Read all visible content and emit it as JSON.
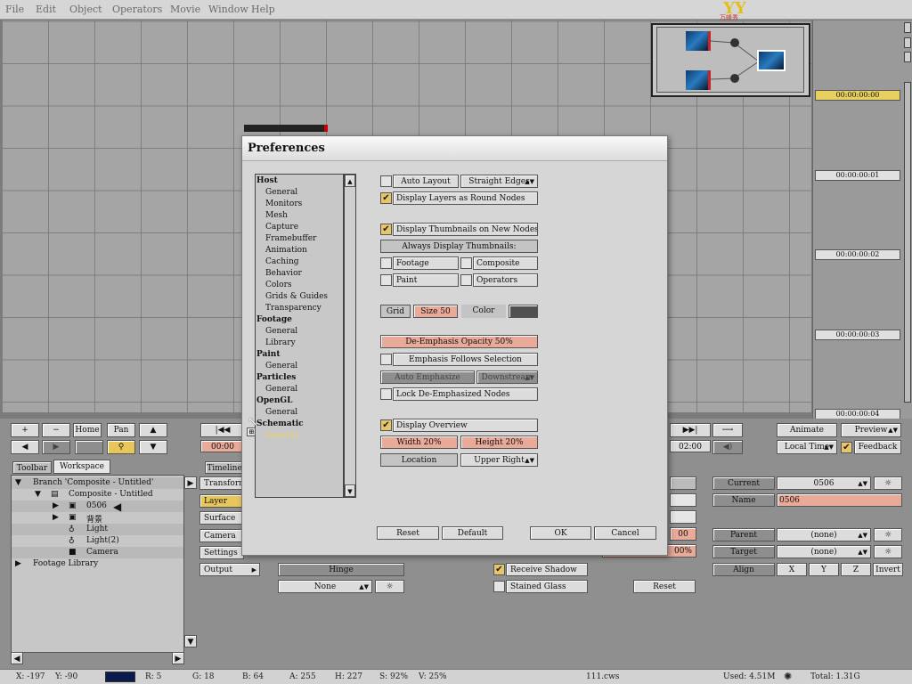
{
  "menu": [
    "File",
    "Edit",
    "Object",
    "Operators",
    "Movie",
    "Window",
    "Help"
  ],
  "logo": {
    "text": "YY",
    "sub": "万峰秀"
  },
  "timeline": {
    "times": [
      "00:00:00:00",
      "00:00:00:01",
      "00:00:00:02",
      "00:00:00:03",
      "00:00:00:04"
    ]
  },
  "toolbar": {
    "add": "+",
    "remove": "−",
    "home": "Home",
    "pan": "Pan",
    "start_time": "00:00",
    "end_time": "02:00",
    "animate": "Animate",
    "preview": "Preview",
    "local_time": "Local Time",
    "feedback": "Feedback"
  },
  "tabs": {
    "toolbar": "Toolbar",
    "workspace": "Workspace",
    "timeline": "Timeline"
  },
  "tree": [
    {
      "text": "Branch 'Composite - Untitled'"
    },
    {
      "text": "Composite - Untitled"
    },
    {
      "text": "0506"
    },
    {
      "text": "背景"
    },
    {
      "text": "Light"
    },
    {
      "text": "Light(2)"
    },
    {
      "text": "Camera"
    },
    {
      "text": "Footage Library"
    }
  ],
  "side_buttons": [
    "Transform",
    "Layer",
    "Surface",
    "Camera",
    "Settings",
    "Output"
  ],
  "hinge": {
    "label": "Hinge",
    "value": "None"
  },
  "surface": {
    "receive_shadow": "Receive Shadow",
    "stained_glass": "Stained Glass",
    "reset": "Reset",
    "pct1": "00",
    "pct2": "00%"
  },
  "props": {
    "current_label": "Current",
    "current_value": "0506",
    "name_label": "Name",
    "name_value": "0506",
    "parent_label": "Parent",
    "parent_value": "(none)",
    "target_label": "Target",
    "target_value": "(none)",
    "align_label": "Align",
    "x": "X",
    "y": "Y",
    "z": "Z",
    "invert": "Invert"
  },
  "dialog": {
    "title": "Preferences",
    "categories": [
      {
        "t": "Host",
        "h": true
      },
      {
        "t": "General"
      },
      {
        "t": "Monitors"
      },
      {
        "t": "Mesh"
      },
      {
        "t": "Capture"
      },
      {
        "t": "Framebuffer"
      },
      {
        "t": "Animation"
      },
      {
        "t": "Caching"
      },
      {
        "t": "Behavior"
      },
      {
        "t": "Colors"
      },
      {
        "t": "Grids & Guides"
      },
      {
        "t": "Transparency"
      },
      {
        "t": "Footage",
        "h": true
      },
      {
        "t": "General"
      },
      {
        "t": "Library"
      },
      {
        "t": "Paint",
        "h": true
      },
      {
        "t": "General"
      },
      {
        "t": "Particles",
        "h": true
      },
      {
        "t": "General"
      },
      {
        "t": "OpenGL",
        "h": true
      },
      {
        "t": "General"
      },
      {
        "t": "Schematic",
        "h": true
      },
      {
        "t": "General",
        "sel": true
      }
    ],
    "auto_layout": "Auto Layout",
    "straight_edges": "Straight Edges",
    "round_nodes": "Display Layers as Round Nodes",
    "thumbs_new": "Display Thumbnails on New Nodes",
    "always_thumbs": "Always Display Thumbnails:",
    "footage": "Footage",
    "composite": "Composite",
    "paint": "Paint",
    "operators": "Operators",
    "grid": "Grid",
    "size": "Size 50",
    "color": "Color",
    "grid_color": "#505050",
    "deemph": "De-Emphasis Opacity 50%",
    "deemph_pct": 0.5,
    "emph_follows": "Emphasis Follows Selection",
    "auto_emph": "Auto Emphasize",
    "downstream": "Downstream",
    "lock": "Lock De-Emphasized Nodes",
    "overview": "Display Overview",
    "width": "Width 20%",
    "height": "Height 20%",
    "location": "Location",
    "location_value": "Upper Right",
    "reset": "Reset",
    "default": "Default",
    "ok": "OK",
    "cancel": "Cancel"
  },
  "status": {
    "x": "X: -197",
    "y": "Y: -90",
    "r": "R: 5",
    "g": "G: 18",
    "b": "B: 64",
    "a": "A: 255",
    "h": "H: 227",
    "s": "S: 92%",
    "v": "V: 25%",
    "file": "111.cws",
    "used": "Used: 4.51M",
    "total": "Total: 1.31G",
    "swatch": "#0a1a4a"
  }
}
